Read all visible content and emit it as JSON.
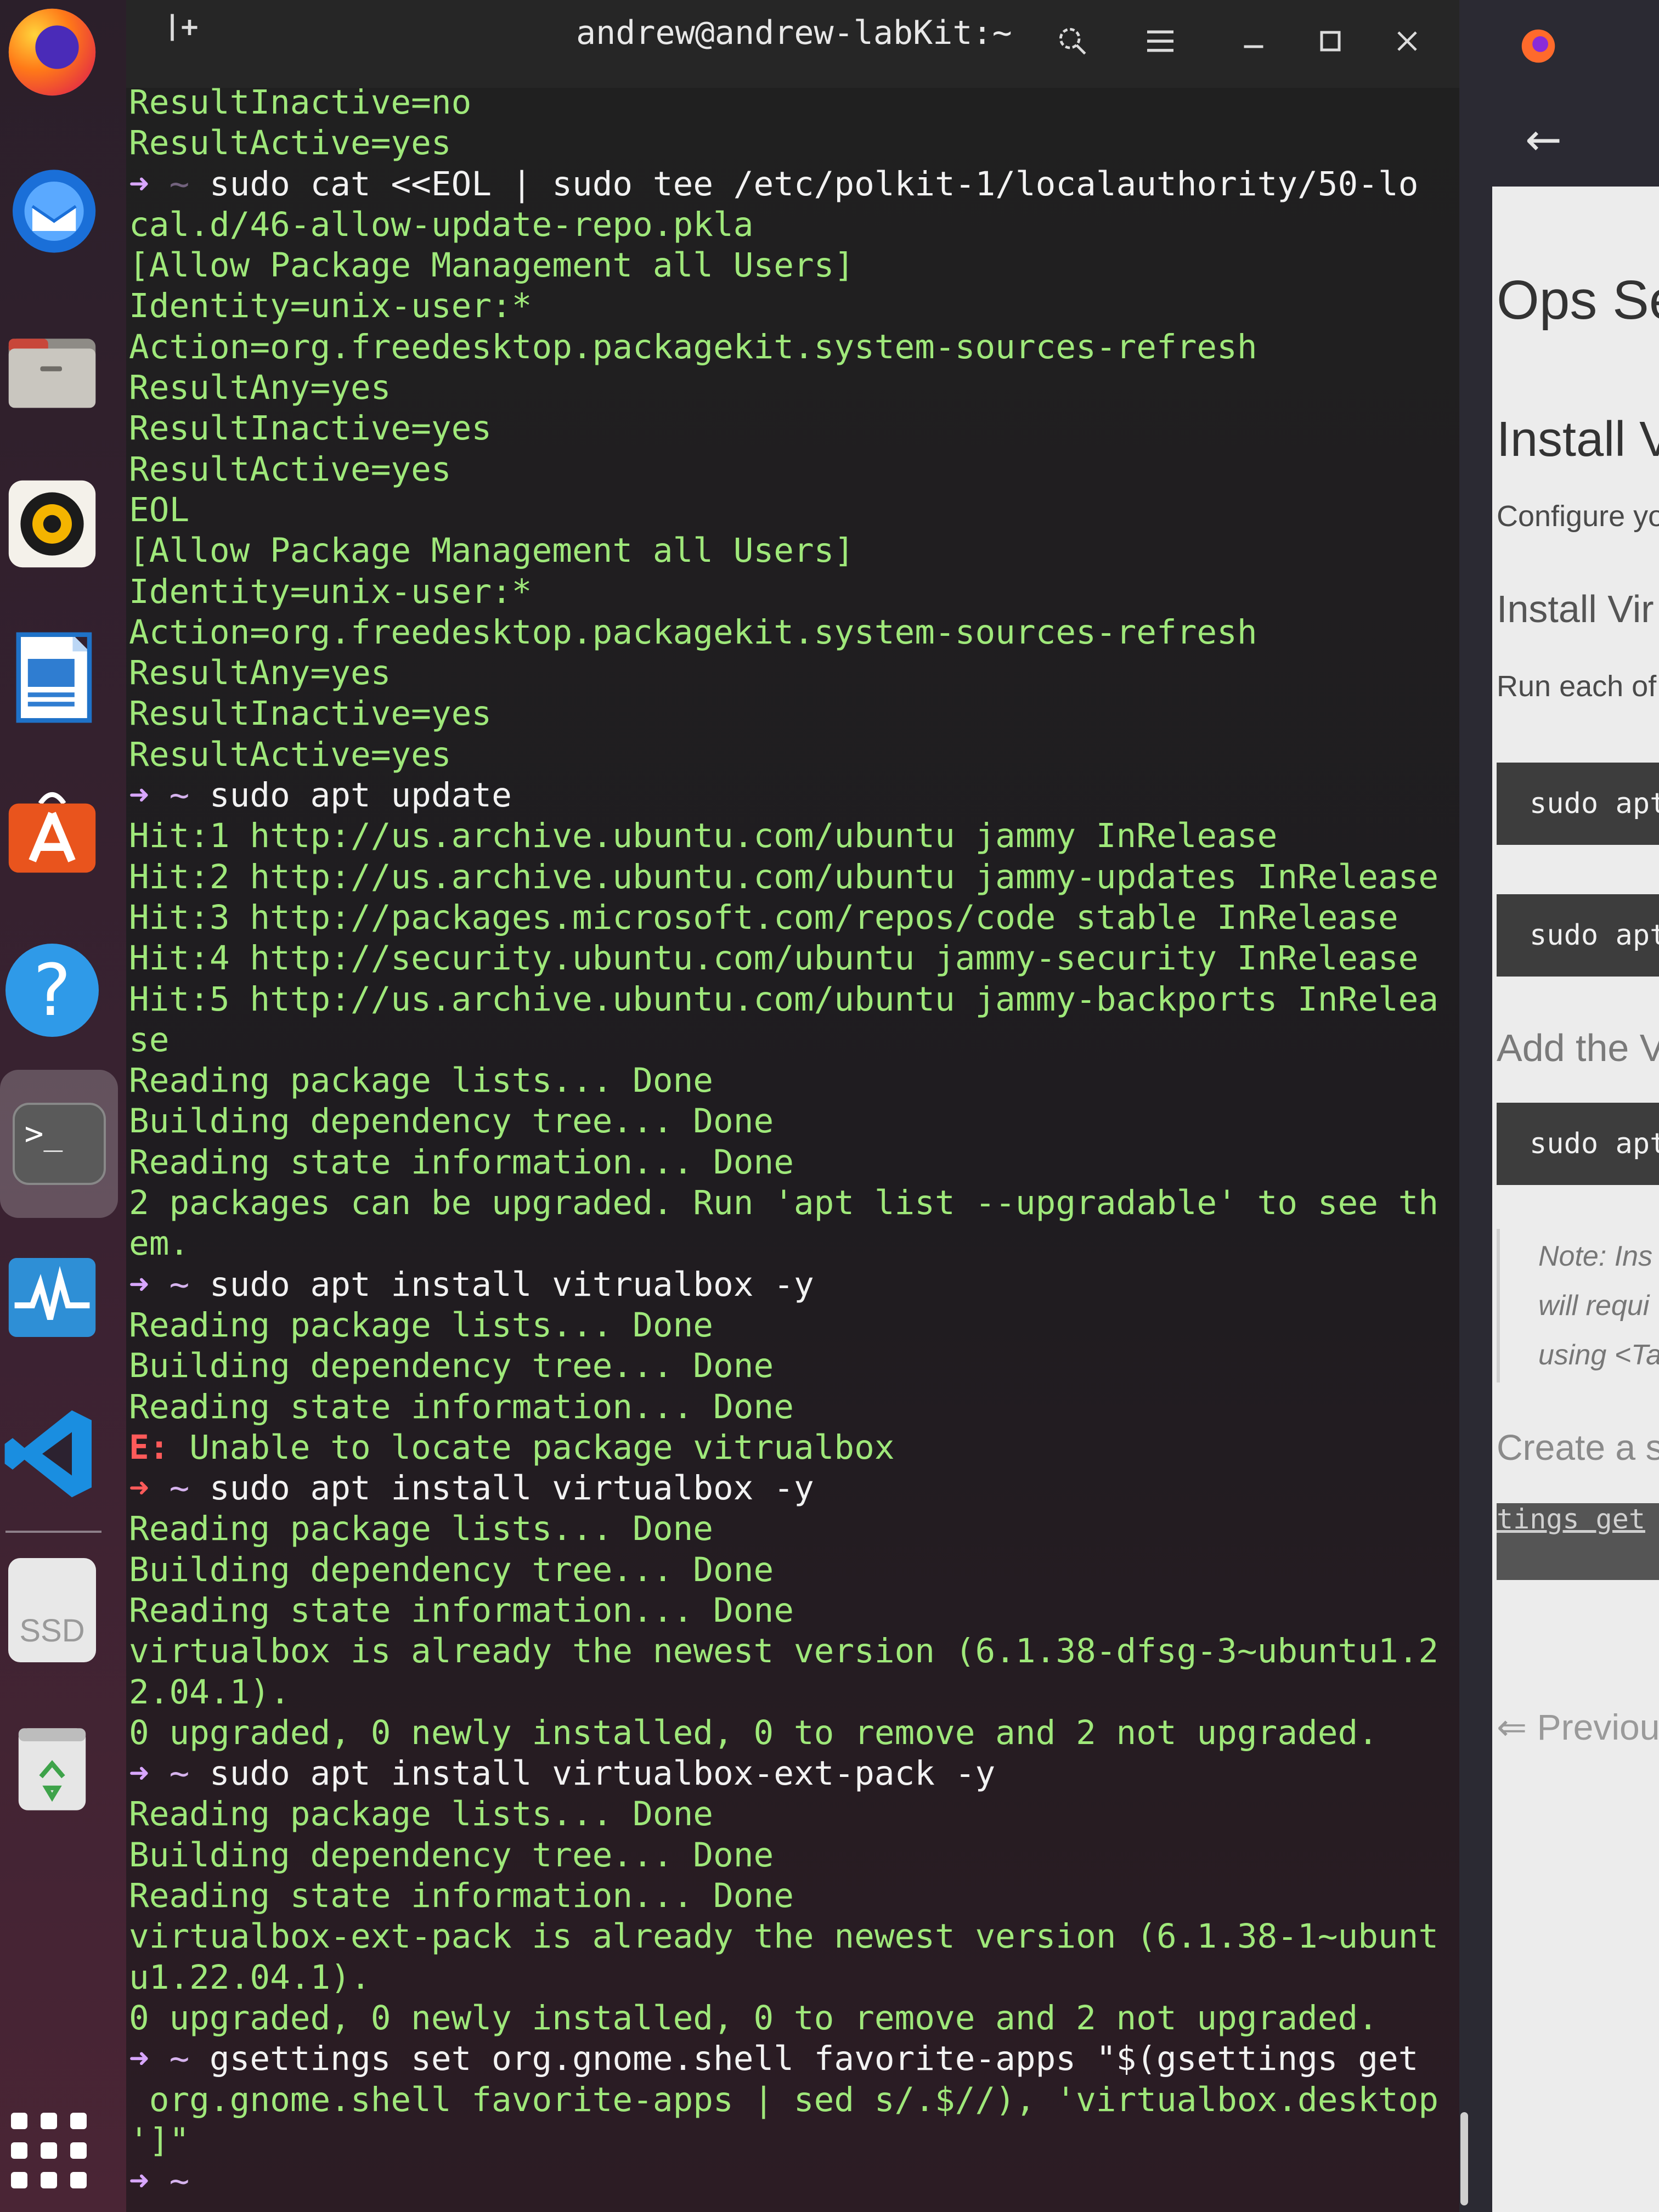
{
  "dock": {
    "items": [
      {
        "name": "firefox-icon"
      },
      {
        "name": "thunderbird-icon"
      },
      {
        "name": "files-icon"
      },
      {
        "name": "rhythmbox-icon"
      },
      {
        "name": "libreoffice-writer-icon"
      },
      {
        "name": "app-center-icon"
      },
      {
        "name": "help-icon",
        "glyph": "?"
      },
      {
        "name": "terminal-icon",
        "glyph": ">_"
      },
      {
        "name": "system-monitor-icon"
      },
      {
        "name": "vscode-icon"
      },
      {
        "name": "ssd-drive-icon",
        "label": "SSD"
      },
      {
        "name": "trash-icon"
      }
    ],
    "grid_glyph": "⋮⋮⋮"
  },
  "terminal": {
    "title": "andrew@andrew-labKit:~",
    "new_tab_glyph": "⊞",
    "lines": [
      {
        "t": "out",
        "text": "ResultInactive=no"
      },
      {
        "t": "out",
        "text": "ResultActive=yes"
      },
      {
        "t": "cmd",
        "text": "sudo cat <<EOL | sudo tee /etc/polkit-1/localauthority/50-lo",
        "faded": true
      },
      {
        "t": "out",
        "text": "cal.d/46-allow-update-repo.pkla"
      },
      {
        "t": "out",
        "text": "[Allow Package Management all Users]"
      },
      {
        "t": "out",
        "text": "Identity=unix-user:*"
      },
      {
        "t": "out",
        "text": "Action=org.freedesktop.packagekit.system-sources-refresh"
      },
      {
        "t": "out",
        "text": "ResultAny=yes"
      },
      {
        "t": "out",
        "text": "ResultInactive=yes"
      },
      {
        "t": "out",
        "text": "ResultActive=yes"
      },
      {
        "t": "out",
        "text": "EOL"
      },
      {
        "t": "out",
        "text": "[Allow Package Management all Users]"
      },
      {
        "t": "out",
        "text": "Identity=unix-user:*"
      },
      {
        "t": "out",
        "text": "Action=org.freedesktop.packagekit.system-sources-refresh"
      },
      {
        "t": "out",
        "text": "ResultAny=yes"
      },
      {
        "t": "out",
        "text": "ResultInactive=yes"
      },
      {
        "t": "out",
        "text": "ResultActive=yes"
      },
      {
        "t": "cmd",
        "text": "sudo apt update"
      },
      {
        "t": "out",
        "text": "Hit:1 http://us.archive.ubuntu.com/ubuntu jammy InRelease"
      },
      {
        "t": "out",
        "text": "Hit:2 http://us.archive.ubuntu.com/ubuntu jammy-updates InRelease"
      },
      {
        "t": "out",
        "text": "Hit:3 http://packages.microsoft.com/repos/code stable InRelease"
      },
      {
        "t": "out",
        "text": "Hit:4 http://security.ubuntu.com/ubuntu jammy-security InRelease"
      },
      {
        "t": "out",
        "text": "Hit:5 http://us.archive.ubuntu.com/ubuntu jammy-backports InRelea"
      },
      {
        "t": "out",
        "text": "se"
      },
      {
        "t": "out",
        "text": "Reading package lists... Done"
      },
      {
        "t": "out",
        "text": "Building dependency tree... Done"
      },
      {
        "t": "out",
        "text": "Reading state information... Done"
      },
      {
        "t": "out",
        "text": "2 packages can be upgraded. Run 'apt list --upgradable' to see th"
      },
      {
        "t": "out",
        "text": "em."
      },
      {
        "t": "cmd",
        "text": "sudo apt install vitrualbox -y"
      },
      {
        "t": "out",
        "text": "Reading package lists... Done"
      },
      {
        "t": "out",
        "text": "Building dependency tree... Done"
      },
      {
        "t": "out",
        "text": "Reading state information... Done"
      },
      {
        "t": "err",
        "prefix": "E:",
        "text": " Unable to locate package vitrualbox"
      },
      {
        "t": "cmd",
        "text": "sudo apt install virtualbox -y",
        "failed": true
      },
      {
        "t": "out",
        "text": "Reading package lists... Done"
      },
      {
        "t": "out",
        "text": "Building dependency tree... Done"
      },
      {
        "t": "out",
        "text": "Reading state information... Done"
      },
      {
        "t": "out",
        "text": "virtualbox is already the newest version (6.1.38-dfsg-3~ubuntu1.2"
      },
      {
        "t": "out",
        "text": "2.04.1)."
      },
      {
        "t": "out",
        "text": "0 upgraded, 0 newly installed, 0 to remove and 2 not upgraded."
      },
      {
        "t": "cmd",
        "text": "sudo apt install virtualbox-ext-pack -y"
      },
      {
        "t": "out",
        "text": "Reading package lists... Done"
      },
      {
        "t": "out",
        "text": "Building dependency tree... Done"
      },
      {
        "t": "out",
        "text": "Reading state information... Done"
      },
      {
        "t": "out",
        "text": "virtualbox-ext-pack is already the newest version (6.1.38-1~ubunt"
      },
      {
        "t": "out",
        "text": "u1.22.04.1)."
      },
      {
        "t": "out",
        "text": "0 upgraded, 0 newly installed, 0 to remove and 2 not upgraded."
      },
      {
        "t": "cmd",
        "text": "gsettings set org.gnome.shell favorite-apps \"$(gsettings get"
      },
      {
        "t": "out",
        "text": " org.gnome.shell favorite-apps | sed s/.$//), 'virtualbox.desktop"
      },
      {
        "t": "out",
        "text": "']\""
      },
      {
        "t": "prompt",
        "text": ""
      }
    ],
    "prompt_arrow": "➜",
    "prompt_dir": "~",
    "colors": {
      "output": "#9fe87a",
      "arrow": "#d8a6ff",
      "error_arrow": "#ff5a5a",
      "command": "#f2f2f2"
    }
  },
  "browser": {
    "back_glyph": "←",
    "heading": "Ops Se",
    "subheading": "Install V",
    "configure_text": "Configure yo",
    "install_text": "Install Vir",
    "run_text": "Run each of",
    "code1": "sudo apt",
    "code2": "sudo apt",
    "add_text": "Add the V",
    "code3": "sudo apt",
    "note_lines": [
      "Note: Ins",
      "will requi",
      "using <Ta"
    ],
    "create_text": "Create a s",
    "code4": "tings get",
    "previous_text": "⇐ Previou"
  }
}
